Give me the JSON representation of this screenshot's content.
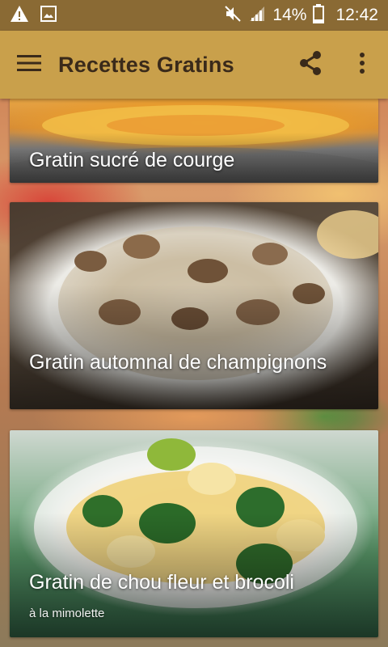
{
  "status_bar": {
    "icons_left": [
      "warning-icon",
      "image-icon"
    ],
    "icons_right": [
      "mute-icon",
      "signal-icon",
      "battery-icon"
    ],
    "battery_percent": "14%",
    "time": "12:42"
  },
  "toolbar": {
    "menu_icon": "hamburger-icon",
    "title": "Recettes Gratins",
    "share_icon": "share-icon",
    "more_icon": "more-vert-icon"
  },
  "recipes": [
    {
      "title": "Gratin sucré de courge",
      "subtitle": ""
    },
    {
      "title": "Gratin automnal de champignons",
      "subtitle": ""
    },
    {
      "title": "Gratin de chou fleur et brocoli",
      "subtitle": "à la mimolette"
    }
  ],
  "colors": {
    "status_bar": "#8a6a34",
    "toolbar": "#c9a04b",
    "toolbar_text": "#3a2a1a",
    "card_text": "#ffffff"
  }
}
